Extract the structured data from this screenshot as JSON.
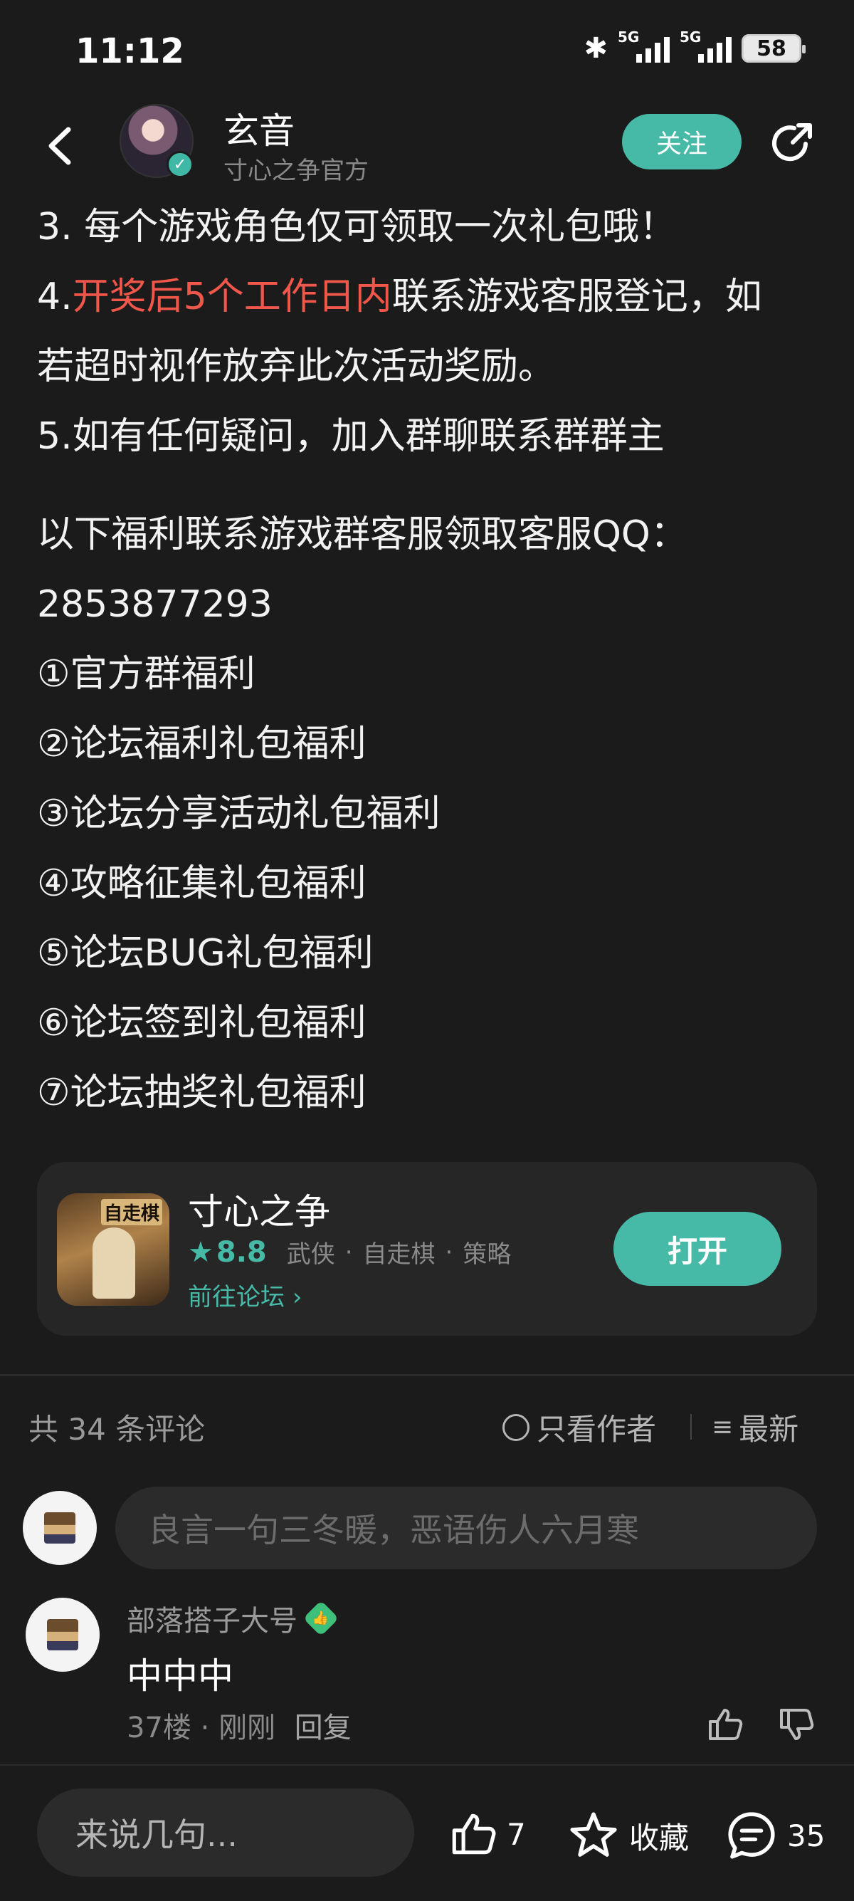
{
  "status_bar": {
    "time": "11:12",
    "signal1_label": "5G",
    "signal2_label": "5G",
    "battery": "58"
  },
  "header": {
    "author_name": "玄音",
    "author_subtitle": "寸心之争官方",
    "follow_label": "关注"
  },
  "article": {
    "line3": "3. 每个游戏角色仅可领取一次礼包哦！",
    "line4_prefix": "4.",
    "line4_highlight": "开奖后5个工作日内",
    "line4_suffix": "联系游戏客服登记，如",
    "line4_cont": "若超时视作放弃此次活动奖励。",
    "line5": "5.如有任何疑问，加入群聊联系群群主",
    "benefit_intro": "以下福利联系游戏群客服领取客服QQ：",
    "qq_number": "2853877293",
    "benefits": [
      "①官方群福利",
      "②论坛福利礼包福利",
      "③论坛分享活动礼包福利",
      "④攻略征集礼包福利",
      "⑤论坛BUG礼包福利",
      "⑥论坛签到礼包福利",
      "⑦论坛抽奖礼包福利"
    ]
  },
  "game_card": {
    "icon_text": "自走棋",
    "title": "寸心之争",
    "rating": "8.8",
    "tags": [
      "武侠",
      "自走棋",
      "策略"
    ],
    "forum_link": "前往论坛",
    "open_label": "打开"
  },
  "comments": {
    "count_label": "共 34 条评论",
    "author_only_label": "只看作者",
    "sort_label": "最新",
    "input_placeholder": "良言一句三冬暖，恶语伤人六月寒",
    "items": [
      {
        "user": "部落搭子大号",
        "text": "中中中",
        "floor": "37楼",
        "time": "刚刚",
        "reply_label": "回复"
      }
    ]
  },
  "bottom_bar": {
    "input_placeholder": "来说几句...",
    "like_count": "7",
    "favorite_label": "收藏",
    "comment_count": "35"
  },
  "colors": {
    "accent": "#47b9a7",
    "highlight_red": "#f0574a",
    "background": "#1b1b1b"
  }
}
